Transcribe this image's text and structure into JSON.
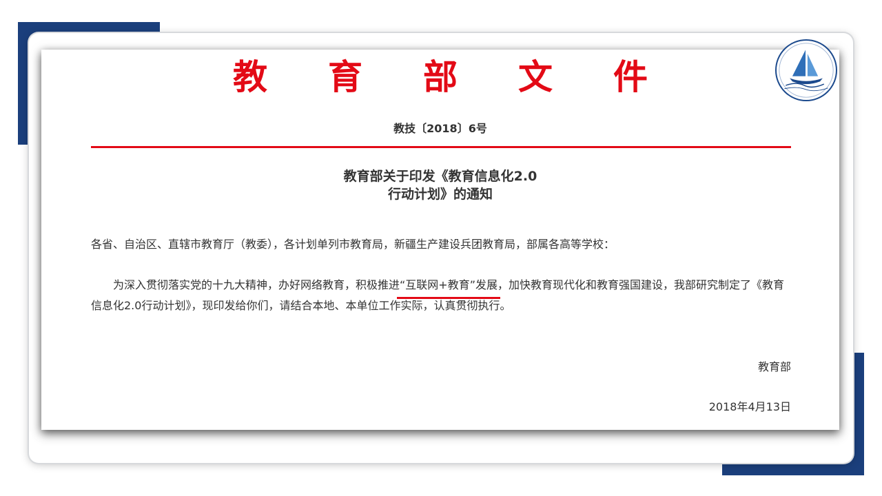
{
  "masthead": {
    "chars": [
      "教",
      "育",
      "部",
      "文",
      "件"
    ]
  },
  "doc_number": "教技〔2018〕6号",
  "title": {
    "line1": "教育部关于印发《教育信息化2.0",
    "line2": "行动计划》的通知"
  },
  "salutation": "各省、自治区、直辖市教育厅（教委），各计划单列市教育局，新疆生产建设兵团教育局，部属各高等学校：",
  "body": {
    "before": "为深入贯彻落实党的十九大精神，办好网络教育，积极推进",
    "highlight": "“互联网+教育”发展",
    "after": "，加快教育现代化和教育强国建设，我部研究制定了《教育信息化2.0行动计划》，现印发给你们，请结合本地、本单位工作实际，认真贯彻执行。"
  },
  "signature": "教育部",
  "date": "2018年4月13日",
  "logo": {
    "icon": "school-sail-logo-icon"
  },
  "colors": {
    "accent": "#1b3f7c",
    "red": "#e30a16",
    "text": "#333333"
  }
}
